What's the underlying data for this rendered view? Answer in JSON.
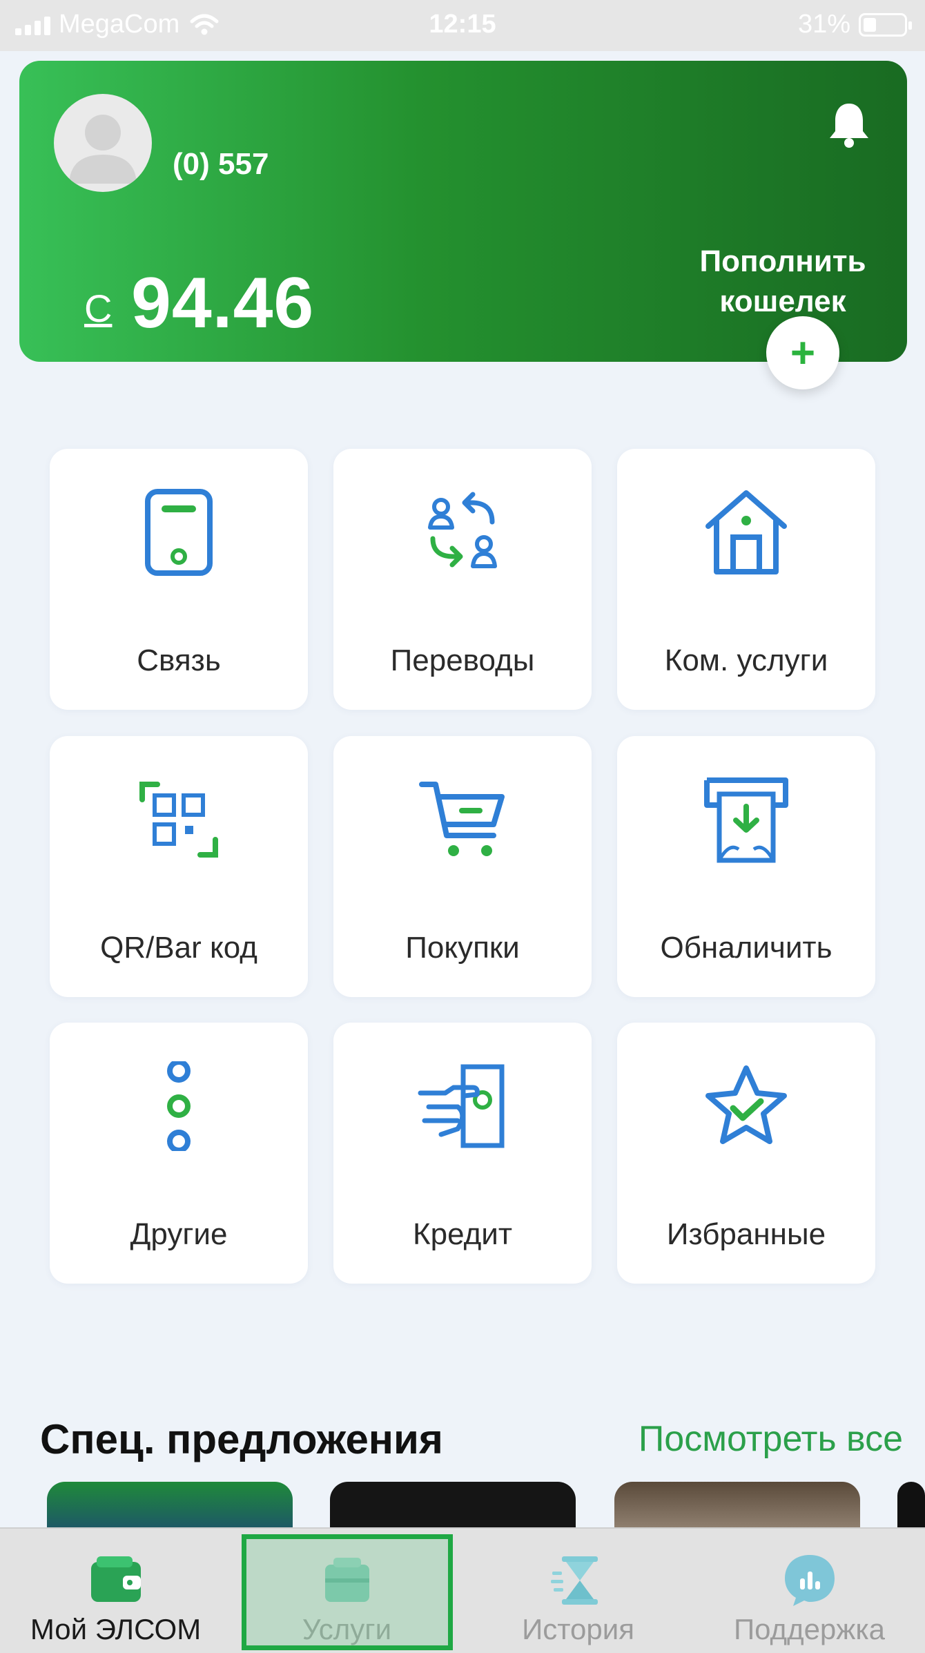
{
  "status_bar": {
    "carrier": "MegaCom",
    "time": "12:15",
    "battery": "31%"
  },
  "wallet": {
    "phone": "(0) 557",
    "currency": "С",
    "balance": "94.46",
    "topup_label": "Пополнить кошелек",
    "topup_button": "+"
  },
  "services": [
    {
      "label": "Связь",
      "icon": "phone-device-icon"
    },
    {
      "label": "Переводы",
      "icon": "transfer-icon"
    },
    {
      "label": "Ком. услуги",
      "icon": "house-icon"
    },
    {
      "label": "QR/Bar код",
      "icon": "qr-code-icon"
    },
    {
      "label": "Покупки",
      "icon": "shopping-cart-icon"
    },
    {
      "label": "Обналичить",
      "icon": "cash-out-icon"
    },
    {
      "label": "Другие",
      "icon": "more-dots-icon"
    },
    {
      "label": "Кредит",
      "icon": "credit-icon"
    },
    {
      "label": "Избранные",
      "icon": "star-icon"
    }
  ],
  "offers": {
    "title": "Спец. предложения",
    "see_all": "Посмотреть все"
  },
  "nav": [
    {
      "label": "Мой ЭЛСОМ",
      "icon": "wallet-icon"
    },
    {
      "label": "Услуги",
      "icon": "services-icon"
    },
    {
      "label": "История",
      "icon": "hourglass-icon"
    },
    {
      "label": "Поддержка",
      "icon": "support-chat-icon"
    }
  ],
  "colors": {
    "brand_green": "#2bb33e",
    "icon_blue": "#2f7fd6",
    "icon_green": "#2fb044"
  }
}
